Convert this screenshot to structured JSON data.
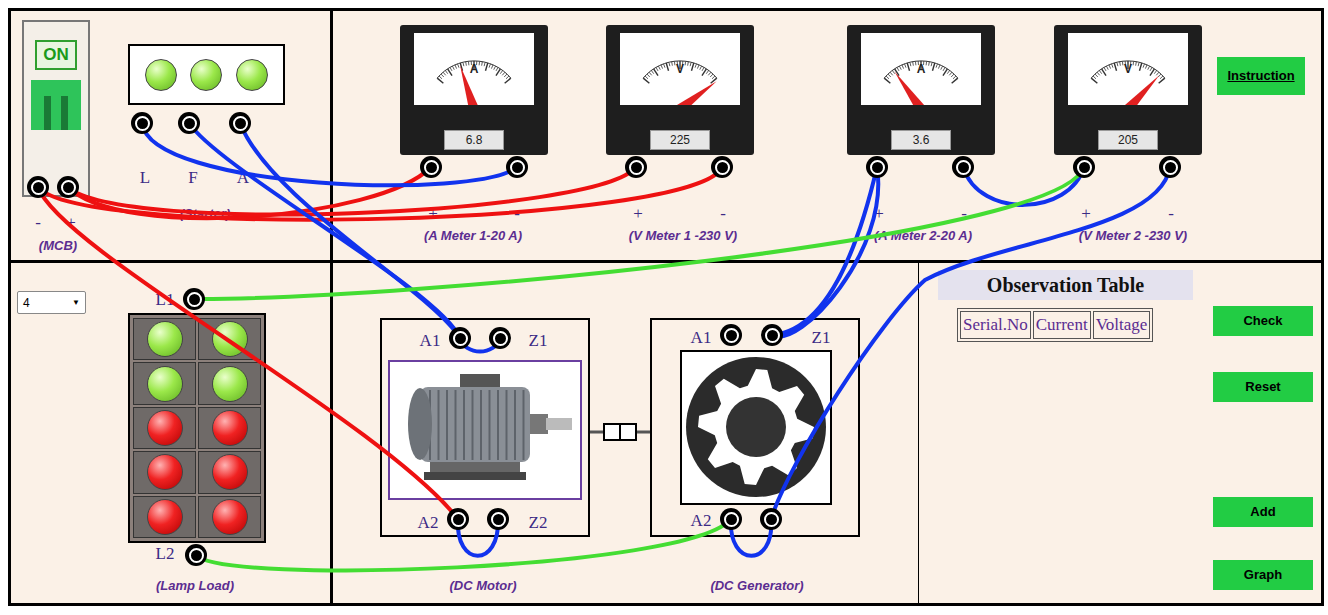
{
  "mcb": {
    "label": "ON",
    "on": true,
    "terminals": [
      "-",
      "+"
    ],
    "caption": "(MCB)"
  },
  "starter": {
    "lamps": [
      {
        "on": true
      },
      {
        "on": true
      },
      {
        "on": true
      }
    ],
    "terminals": [
      "L",
      "F",
      "A"
    ],
    "caption": "(Starter)"
  },
  "meters": [
    {
      "unit": "A",
      "reading": "6.8",
      "level": 0.34,
      "plus": "+",
      "minus": "-",
      "caption": "(A Meter 1-20 A)"
    },
    {
      "unit": "V",
      "reading": "225",
      "level": 0.98,
      "plus": "+",
      "minus": "-",
      "caption": "(V Meter 1 -230 V)"
    },
    {
      "unit": "A",
      "reading": "3.6",
      "level": 0.18,
      "plus": "+",
      "minus": "-",
      "caption": "(A Meter 2-20 A)"
    },
    {
      "unit": "V",
      "reading": "205",
      "level": 0.89,
      "plus": "+",
      "minus": "-",
      "caption": "(V Meter 2 -230 V)"
    }
  ],
  "instruction": "Instruction",
  "lamp_load": {
    "count": {
      "value": "4",
      "arrow": "▼"
    },
    "terminals": [
      "L1",
      "L2"
    ],
    "caption": "(Lamp Load)",
    "lamps": [
      {
        "on": true
      },
      {
        "on": true
      },
      {
        "on": true
      },
      {
        "on": true
      },
      {
        "on": false
      },
      {
        "on": false
      },
      {
        "on": false
      },
      {
        "on": false
      },
      {
        "on": false
      },
      {
        "on": false
      }
    ]
  },
  "motor": {
    "terminals": [
      "A1",
      "Z1",
      "A2",
      "Z2"
    ],
    "caption": "(DC Motor)"
  },
  "generator": {
    "terminals": [
      "A1",
      "Z1",
      "A2"
    ],
    "caption": "(DC Generator)"
  },
  "observation_table": {
    "title": "Observation Table",
    "columns": [
      "Serial.No",
      "Current",
      "Voltage"
    ],
    "rows": []
  },
  "buttons": [
    "Check",
    "Reset",
    "Add",
    "Graph"
  ],
  "wires": [
    {
      "from": "MCB +",
      "to": "A Meter 1 +",
      "color": "#ee1111"
    },
    {
      "from": "MCB +",
      "to": "V Meter 1 +",
      "color": "#ee1111"
    },
    {
      "from": "MCB -",
      "to": "V Meter 1 -",
      "color": "#ee1111"
    },
    {
      "from": "MCB -",
      "to": "DC Motor A2",
      "color": "#ee1111"
    },
    {
      "from": "Starter L",
      "to": "A Meter 1 -",
      "color": "#1133ee"
    },
    {
      "from": "Starter F",
      "to": "DC Motor A1",
      "color": "#1133ee"
    },
    {
      "from": "Starter A",
      "to": "DC Motor A1",
      "color": "#1133ee"
    },
    {
      "from": "DC Motor A1",
      "to": "DC Motor Z1",
      "color": "#1133ee"
    },
    {
      "from": "DC Motor A2",
      "to": "DC Motor Z2",
      "color": "#1133ee"
    },
    {
      "from": "DC Generator Z1",
      "to": "A Meter 2 +",
      "color": "#1133ee"
    },
    {
      "from": "A Meter 2 +",
      "to": "DC Generator Z1",
      "color": "#1133ee"
    },
    {
      "from": "A Meter 2 -",
      "to": "V Meter 2 +",
      "color": "#1133ee"
    },
    {
      "from": "V Meter 2 -",
      "to": "DC Generator Z2",
      "color": "#1133ee"
    },
    {
      "from": "DC Generator A2",
      "to": "DC Generator Z2",
      "color": "#1133ee"
    },
    {
      "from": "V Meter 2 +",
      "to": "Lamp Load L1",
      "color": "#44dd33"
    },
    {
      "from": "Lamp Load L2",
      "to": "DC Generator A2",
      "color": "#44dd33"
    }
  ]
}
